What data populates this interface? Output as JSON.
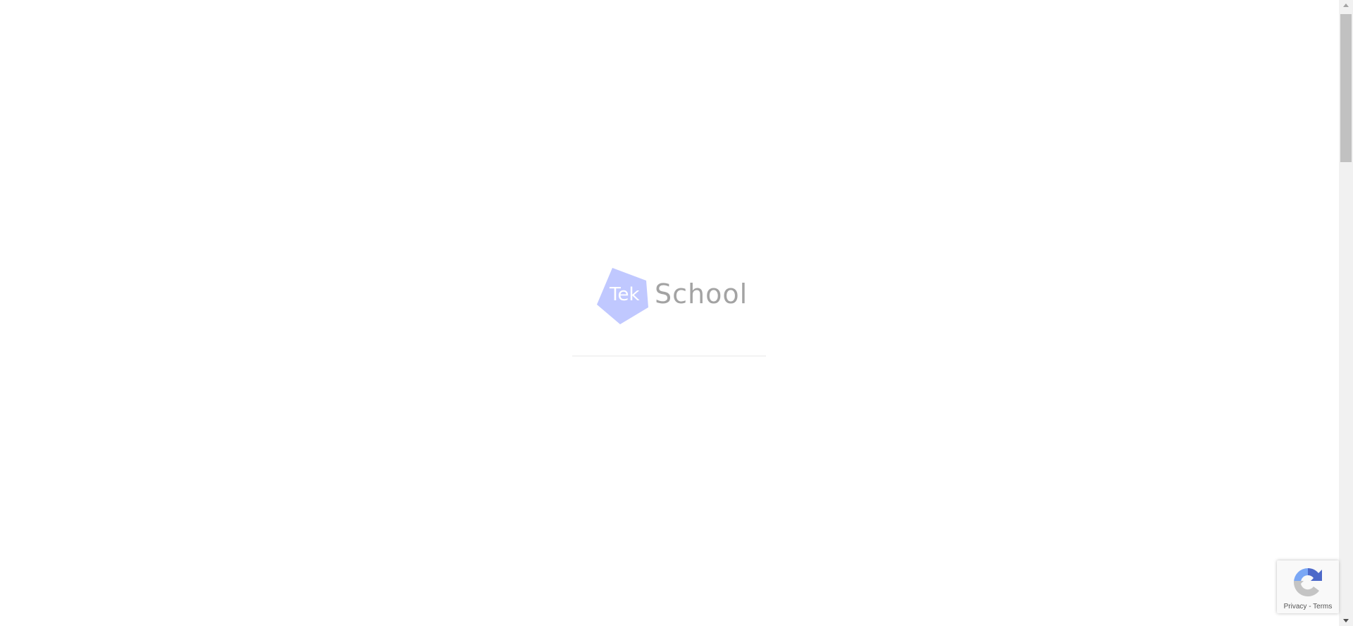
{
  "logo": {
    "part1": "Tek",
    "part2": "School",
    "shape_color": "#c0c8ff",
    "text_color": "#a3a3a3"
  },
  "recaptcha": {
    "privacy": "Privacy",
    "separator": " - ",
    "terms": "Terms"
  }
}
